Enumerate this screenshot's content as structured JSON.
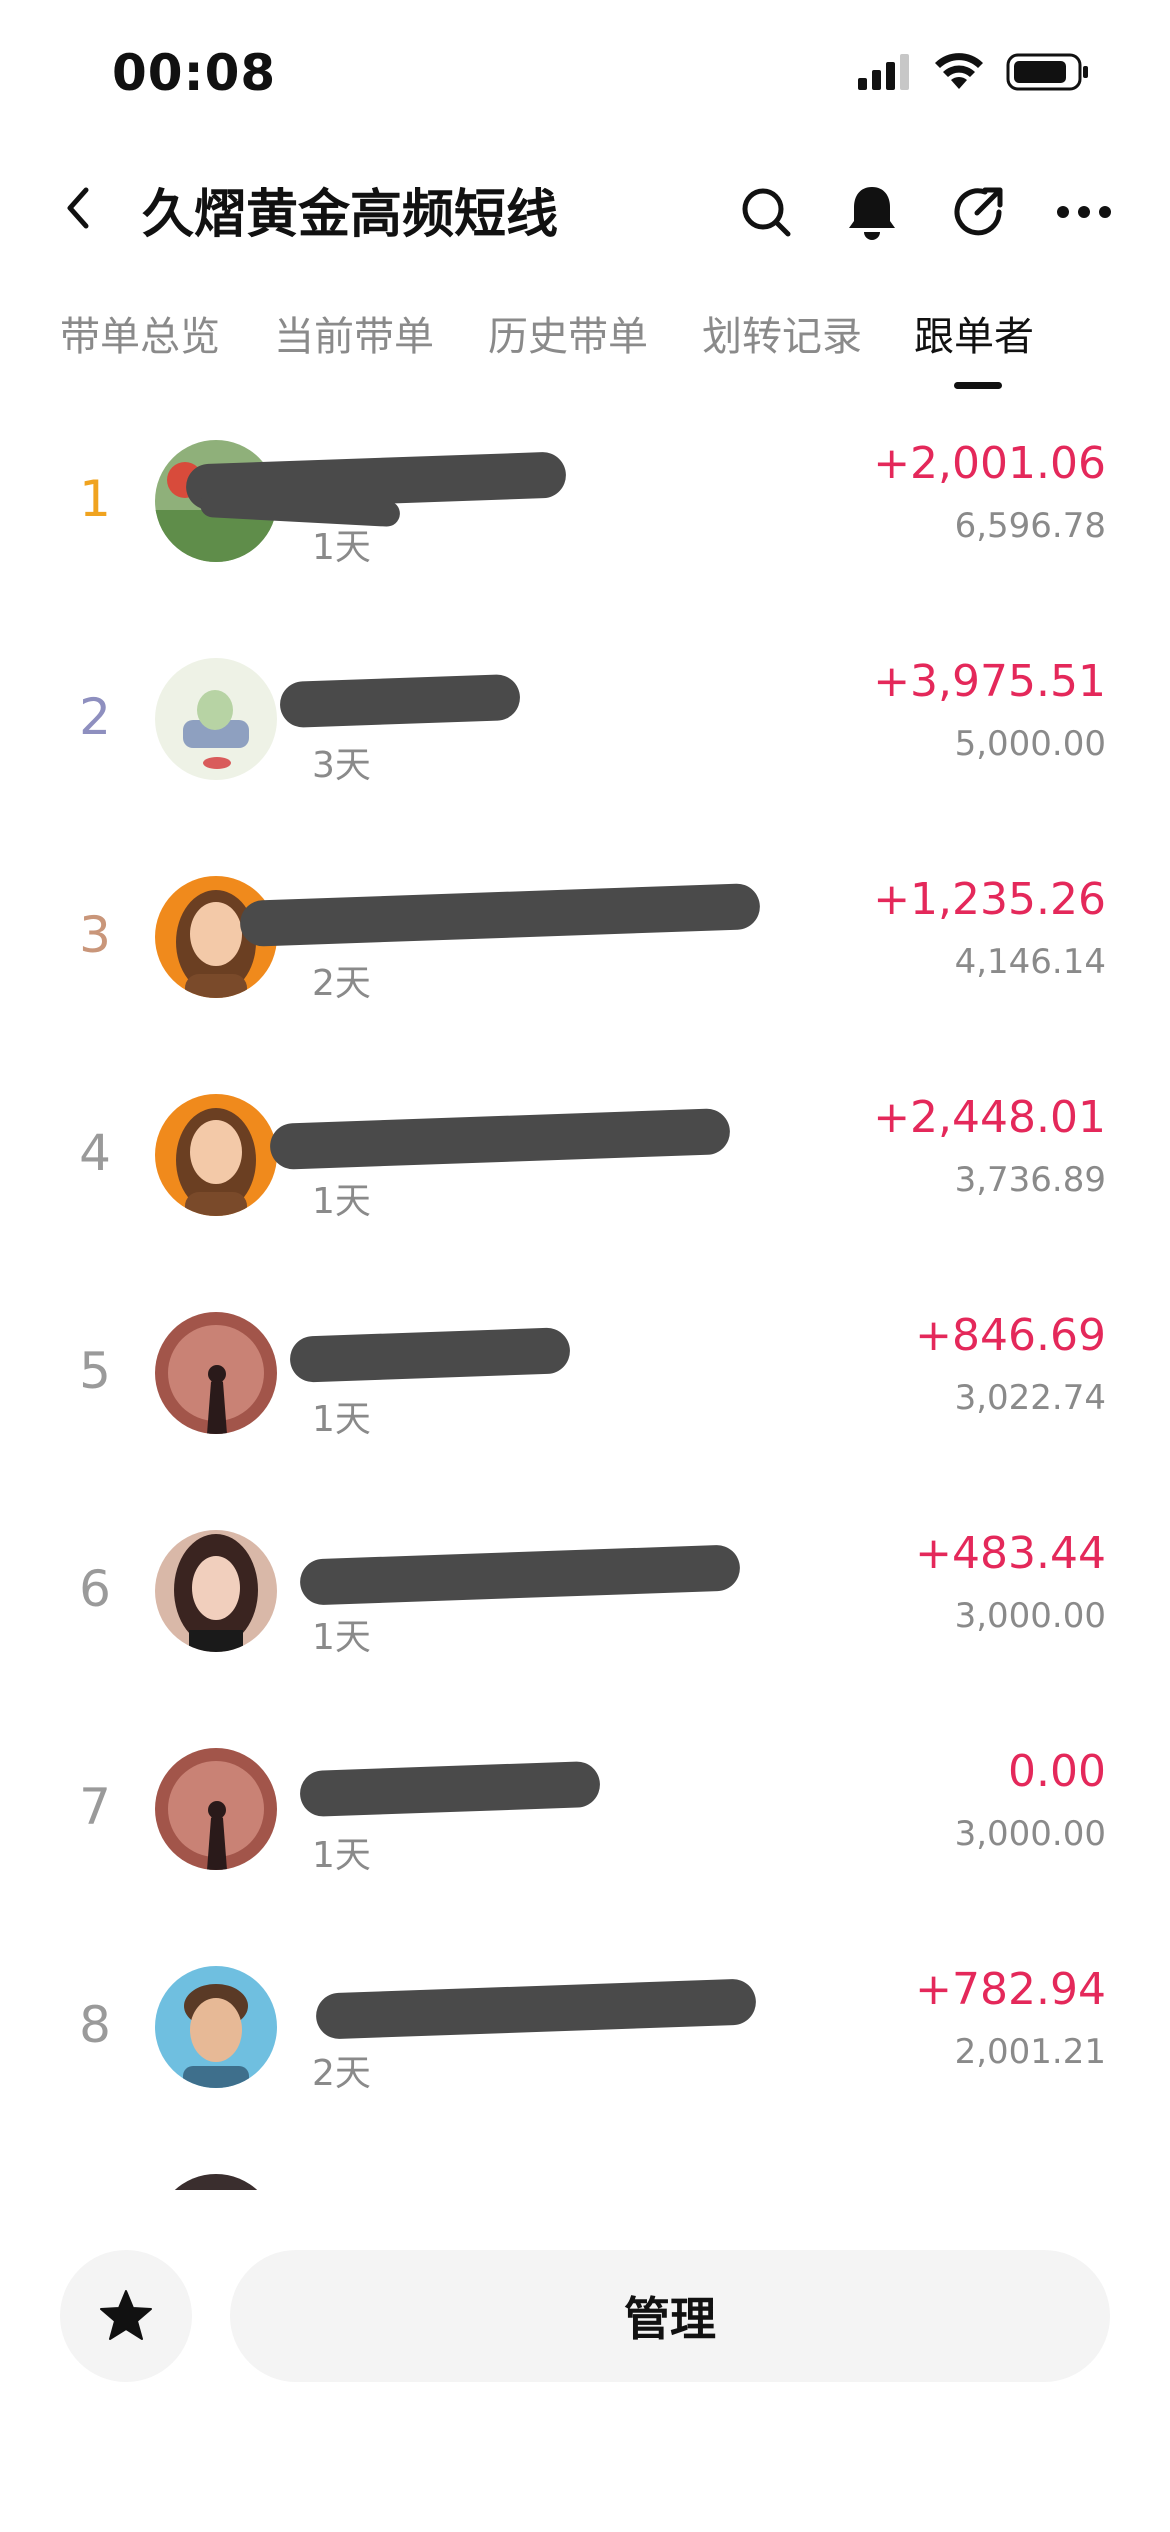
{
  "status_bar": {
    "time": "00:08"
  },
  "header": {
    "title": "久熠黄金高频短线"
  },
  "tabs": [
    {
      "label": "带单总览",
      "active": false
    },
    {
      "label": "当前带单",
      "active": false
    },
    {
      "label": "历史带单",
      "active": false
    },
    {
      "label": "划转记录",
      "active": false
    },
    {
      "label": "跟单者",
      "active": true
    }
  ],
  "followers": [
    {
      "rank": "1",
      "name": "",
      "duration": "1天",
      "pnl": "+2,001.06",
      "amount": "6,596.78"
    },
    {
      "rank": "2",
      "name": "",
      "duration": "3天",
      "pnl": "+3,975.51",
      "amount": "5,000.00"
    },
    {
      "rank": "3",
      "name": "",
      "duration": "2天",
      "pnl": "+1,235.26",
      "amount": "4,146.14"
    },
    {
      "rank": "4",
      "name": "",
      "duration": "1天",
      "pnl": "+2,448.01",
      "amount": "3,736.89"
    },
    {
      "rank": "5",
      "name": "",
      "duration": "1天",
      "pnl": "+846.69",
      "amount": "3,022.74"
    },
    {
      "rank": "6",
      "name": "",
      "duration": "1天",
      "pnl": "+483.44",
      "amount": "3,000.00"
    },
    {
      "rank": "7",
      "name": "",
      "duration": "1天",
      "pnl": "0.00",
      "amount": "3,000.00"
    },
    {
      "rank": "8",
      "name": "",
      "duration": "2天",
      "pnl": "+782.94",
      "amount": "2,001.21"
    }
  ],
  "bottom": {
    "manage_label": "管理"
  },
  "colors": {
    "profit": "#e4285a",
    "rank1": "#f0a31f",
    "rank2": "#8e8fbf",
    "rank3": "#c9967a",
    "rank_other": "#9a9a9a",
    "muted_text": "#8a8a8a"
  },
  "icons": {
    "back": "chevron-left-icon",
    "search": "search-icon",
    "bell": "bell-icon",
    "share": "share-icon",
    "more": "more-icon",
    "star": "star-icon"
  }
}
